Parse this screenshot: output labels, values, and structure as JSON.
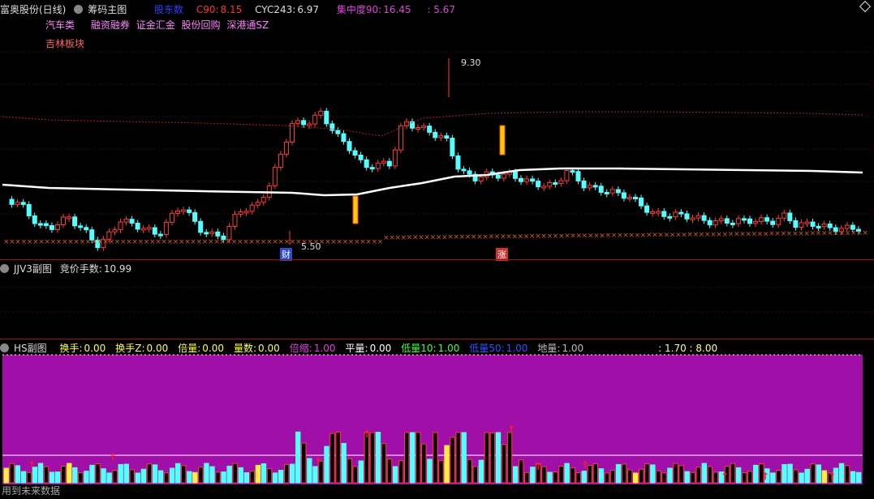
{
  "main_header": {
    "stock_name": "富奥股份(日线)",
    "indicator": "筹码主图",
    "shareholders": "股东数",
    "c90_label": "C90:",
    "c90_value": "8.15",
    "cyc_label": "CYC243:",
    "cyc_value": "6.97",
    "conc_label": "集中度90:",
    "conc_value": "16.45",
    "extra": ": 5.67"
  },
  "sectors": {
    "line1": [
      "汽车类",
      "融资融券",
      "证金汇金",
      "股份回购",
      "深港通SZ"
    ],
    "line2": "吉林板块"
  },
  "price_labels": {
    "high": "9.30",
    "low": "5.50"
  },
  "markers": {
    "cai": "财",
    "zhang": "涨"
  },
  "sub1": {
    "title": "JJV3副图",
    "label": "竞价手数:",
    "value": "10.99"
  },
  "sub2": {
    "title": "HS副图",
    "items": [
      {
        "label": "换手:",
        "value": "0.00",
        "color": "#ffff40"
      },
      {
        "label": "换手Z:",
        "value": "0.00",
        "color": "#ffff40"
      },
      {
        "label": "倍量:",
        "value": "0.00",
        "color": "#ffff40"
      },
      {
        "label": "量数:",
        "value": "0.00",
        "color": "#ffff40"
      },
      {
        "label": "倍缩:",
        "value": "1.00",
        "color": "#e040e0"
      },
      {
        "label": "平量:",
        "value": "0.00",
        "color": "#ffffff"
      },
      {
        "label": "低量10:",
        "value": "1.00",
        "color": "#40ff40"
      },
      {
        "label": "低量50:",
        "value": "1.00",
        "color": "#3050ff"
      },
      {
        "label": "地量:",
        "value": "1.00",
        "color": "#bbbbbb"
      }
    ],
    "tail": ": 1.70 : 8.00"
  },
  "footer": {
    "warning": "用到未来数据"
  },
  "colors": {
    "up": "#ff3b3b",
    "down": "#54ffff",
    "ma": "#ffffff",
    "volbg": "#a010a8",
    "divider": "#9a1414"
  }
}
